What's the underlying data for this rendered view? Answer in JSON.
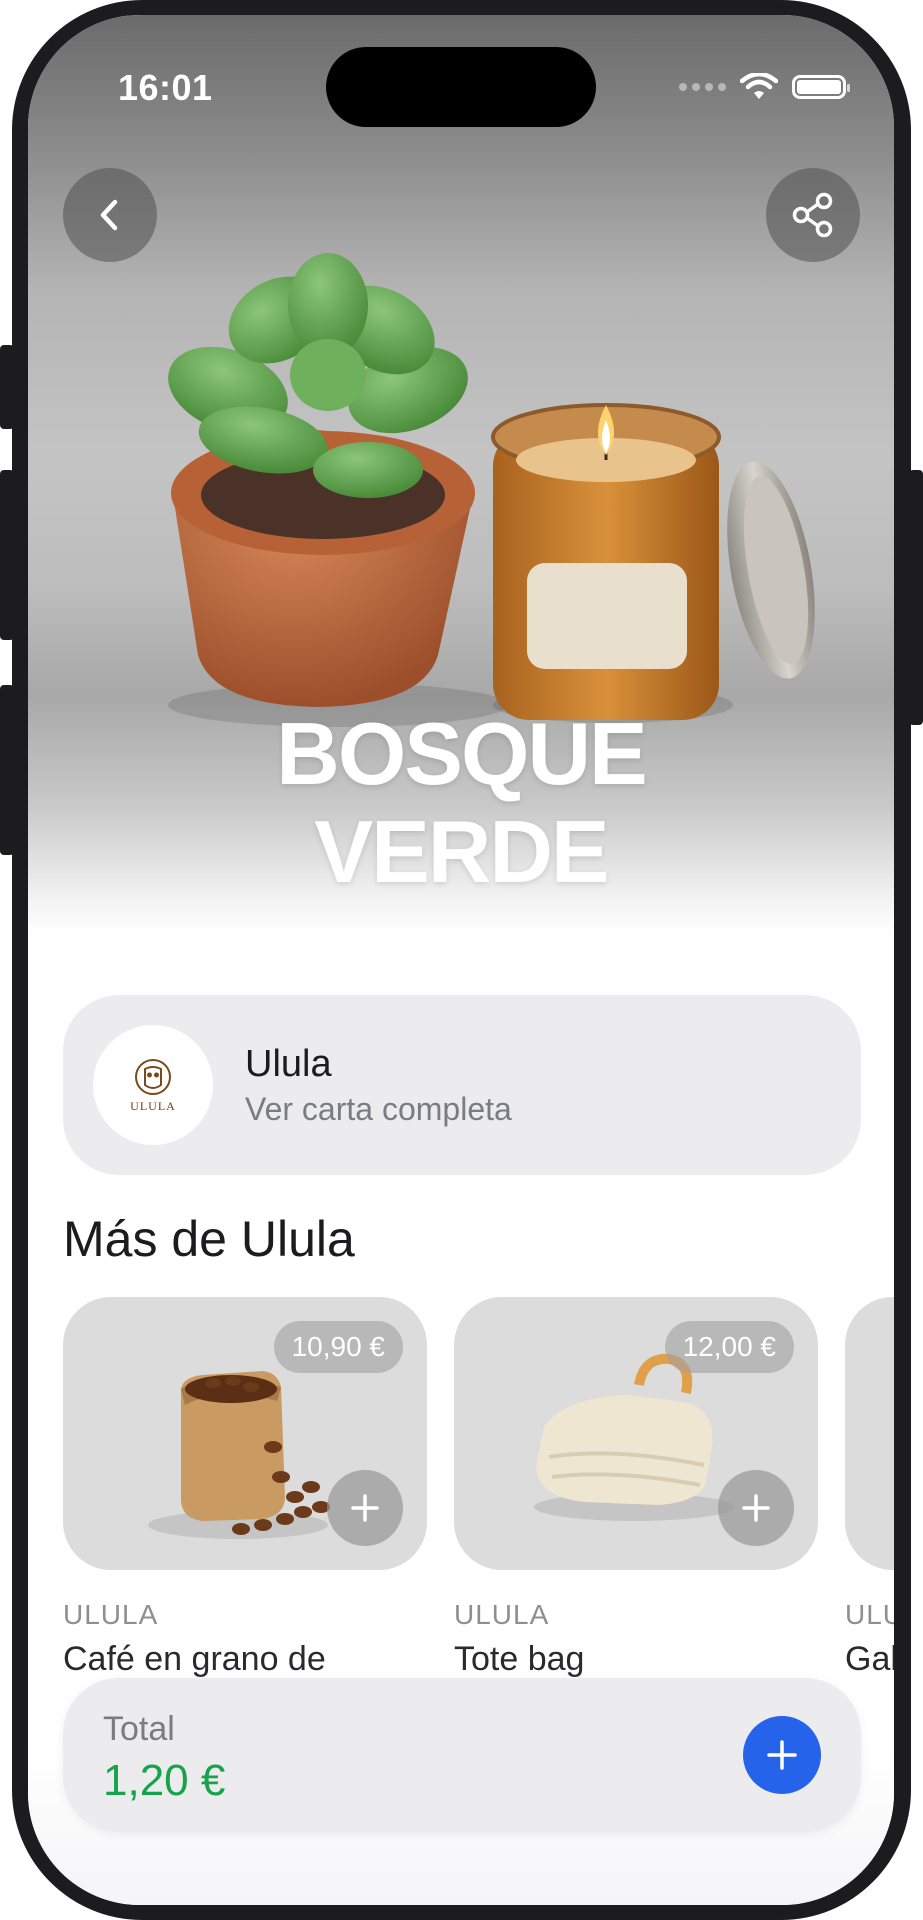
{
  "status_bar": {
    "time": "16:01"
  },
  "header": {
    "back_icon": "chevron-left-icon",
    "share_icon": "share-icon",
    "title_line1": "BOSQUE",
    "title_line2": "VERDE"
  },
  "brand": {
    "name": "Ulula",
    "logo_text": "ULULA",
    "link_label": "Ver carta completa"
  },
  "section": {
    "title": "Más de Ulula"
  },
  "products": [
    {
      "price": "10,90 €",
      "brand": "ULULA",
      "name": "Café en grano de",
      "image": "coffee-bag"
    },
    {
      "price": "12,00 €",
      "brand": "ULULA",
      "name": "Tote bag",
      "image": "tote-bag"
    },
    {
      "price": "",
      "brand": "ULU",
      "name": "Gal",
      "image": "partial"
    }
  ],
  "total": {
    "label": "Total",
    "value": "1,20 €",
    "value_color": "#16a34a",
    "add_color": "#2563eb"
  }
}
